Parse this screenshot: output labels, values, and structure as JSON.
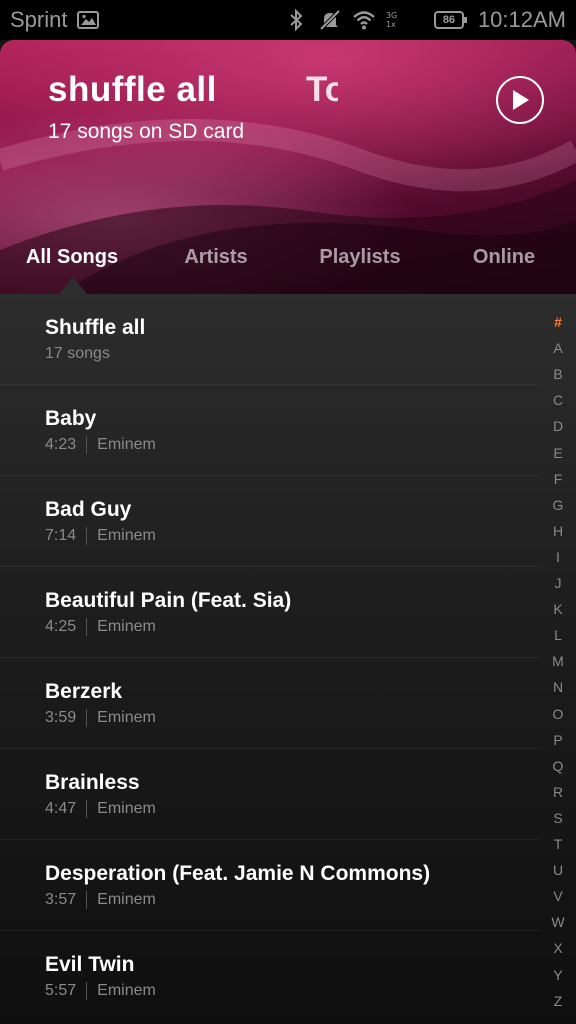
{
  "status_bar": {
    "carrier": "Sprint",
    "network": "3G",
    "network_2": "1x",
    "battery": "86",
    "time": "10:12AM",
    "icons": [
      "gallery-icon",
      "bluetooth-icon",
      "mute-icon",
      "wifi-icon",
      "signal-icon",
      "battery-icon"
    ]
  },
  "header": {
    "title": "shuffle all",
    "next_title": "To",
    "subtitle": "17 songs on SD card",
    "play_icon": "play-icon"
  },
  "tabs": [
    {
      "label": "All Songs",
      "active": true
    },
    {
      "label": "Artists",
      "active": false
    },
    {
      "label": "Playlists",
      "active": false
    },
    {
      "label": "Online",
      "active": false
    }
  ],
  "list": {
    "shuffle": {
      "title": "Shuffle all",
      "subtitle": "17 songs"
    },
    "songs": [
      {
        "title": "Baby",
        "duration": "4:23",
        "artist": "Eminem"
      },
      {
        "title": "Bad Guy",
        "duration": "7:14",
        "artist": "Eminem"
      },
      {
        "title": "Beautiful Pain (Feat. Sia)",
        "duration": "4:25",
        "artist": "Eminem"
      },
      {
        "title": "Berzerk",
        "duration": "3:59",
        "artist": "Eminem"
      },
      {
        "title": "Brainless",
        "duration": "4:47",
        "artist": "Eminem"
      },
      {
        "title": "Desperation (Feat. Jamie N Commons)",
        "duration": "3:57",
        "artist": "Eminem"
      },
      {
        "title": "Evil Twin",
        "duration": "5:57",
        "artist": "Eminem"
      }
    ]
  },
  "index_letters": [
    "#",
    "A",
    "B",
    "C",
    "D",
    "E",
    "F",
    "G",
    "H",
    "I",
    "J",
    "K",
    "L",
    "M",
    "N",
    "O",
    "P",
    "Q",
    "R",
    "S",
    "T",
    "U",
    "V",
    "W",
    "X",
    "Y",
    "Z"
  ],
  "colors": {
    "accent": "#ff7a2a",
    "header": "#8a1446",
    "list_bg": "#1d1d1d"
  }
}
